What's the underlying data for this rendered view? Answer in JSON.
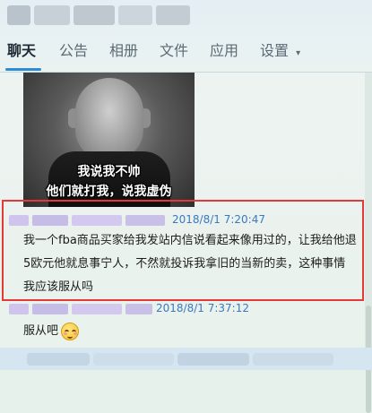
{
  "tabs": [
    {
      "label": "聊天",
      "active": true
    },
    {
      "label": "公告",
      "active": false
    },
    {
      "label": "相册",
      "active": false
    },
    {
      "label": "文件",
      "active": false
    },
    {
      "label": "应用",
      "active": false
    },
    {
      "label": "设置",
      "active": false
    }
  ],
  "settings_caret": "▾",
  "meme": {
    "line1": "我说我不帅",
    "line2": "他们就打我，说我虚伪"
  },
  "messages": [
    {
      "timestamp": "2018/8/1 7:20:47",
      "lines": [
        "我一个fba商品买家给我发站内信说看起来像用过的，让我给他退",
        "5欧元他就息事宁人，不然就投诉我拿旧的当新的卖，这种事情",
        "我应该服从吗"
      ]
    },
    {
      "timestamp": "2018/8/1 7:37:12",
      "text": "服从吧"
    }
  ],
  "colors": {
    "accent": "#2d8cd6",
    "highlight_border": "#e53935",
    "timestamp": "#3a78c0"
  }
}
